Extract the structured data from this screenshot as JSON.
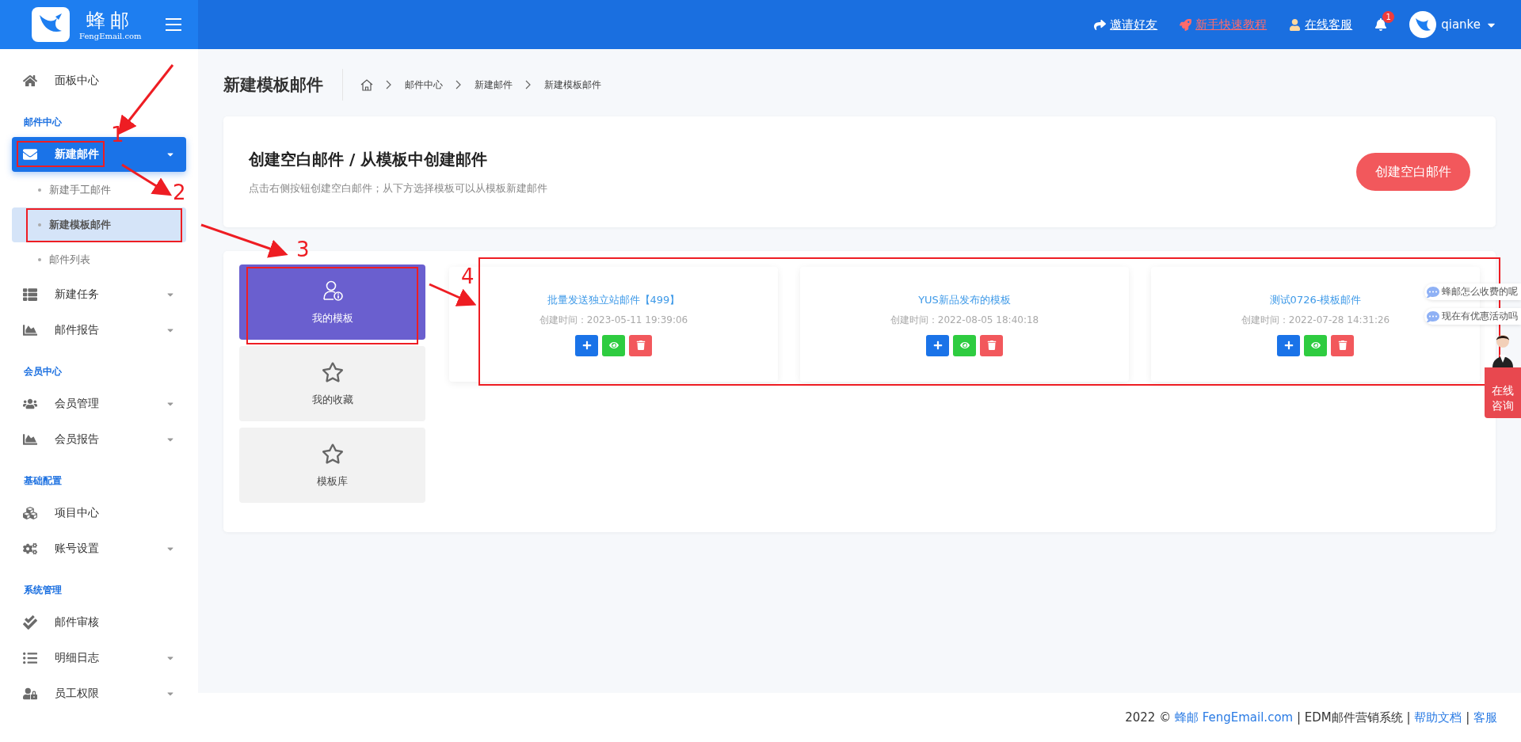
{
  "header": {
    "logo_title": "蜂邮",
    "logo_subtitle": "FengEmail.com",
    "links": [
      {
        "label": "邀请好友",
        "kind": "invite"
      },
      {
        "label": "新手快速教程",
        "kind": "tutorial"
      },
      {
        "label": "在线客服",
        "kind": "service"
      }
    ],
    "notification_count": "1",
    "username": "qianke"
  },
  "sidebar": [
    {
      "kind": "item",
      "label": "面板中心",
      "selected": false,
      "dropdown": false
    },
    {
      "kind": "section",
      "label": "邮件中心"
    },
    {
      "kind": "item",
      "label": "新建邮件",
      "selected": true,
      "dropdown": true
    },
    {
      "kind": "subitem",
      "label": "新建手工邮件",
      "selected": false
    },
    {
      "kind": "subitem",
      "label": "新建模板邮件",
      "selected": true
    },
    {
      "kind": "subitem",
      "label": "邮件列表",
      "selected": false
    },
    {
      "kind": "item",
      "label": "新建任务",
      "selected": false,
      "dropdown": true
    },
    {
      "kind": "item",
      "label": "邮件报告",
      "selected": false,
      "dropdown": true
    },
    {
      "kind": "section",
      "label": "会员中心"
    },
    {
      "kind": "item",
      "label": "会员管理",
      "selected": false,
      "dropdown": true
    },
    {
      "kind": "item",
      "label": "会员报告",
      "selected": false,
      "dropdown": true
    },
    {
      "kind": "section",
      "label": "基础配置"
    },
    {
      "kind": "item",
      "label": "项目中心",
      "selected": false,
      "dropdown": false
    },
    {
      "kind": "item",
      "label": "账号设置",
      "selected": false,
      "dropdown": true
    },
    {
      "kind": "section",
      "label": "系统管理"
    },
    {
      "kind": "item",
      "label": "邮件审核",
      "selected": false,
      "dropdown": false
    },
    {
      "kind": "item",
      "label": "明细日志",
      "selected": false,
      "dropdown": true
    },
    {
      "kind": "item",
      "label": "员工权限",
      "selected": false,
      "dropdown": true
    }
  ],
  "page_title": "新建模板邮件",
  "breadcrumb": [
    "邮件中心",
    "新建邮件",
    "新建模板邮件"
  ],
  "intro": {
    "title": "创建空白邮件 / 从模板中创建邮件",
    "description": "点击右侧按钮创建空白邮件；从下方选择模板可以从模板新建邮件",
    "button": "创建空白邮件"
  },
  "tabs": [
    {
      "label": "我的模板",
      "selected": true
    },
    {
      "label": "我的收藏",
      "selected": false
    },
    {
      "label": "模板库",
      "selected": false
    }
  ],
  "templates": [
    {
      "title": "批量发送独立站邮件【499】",
      "created": "创建时间：2023-05-11 19:39:06"
    },
    {
      "title": "YUS新品发布的模板",
      "created": "创建时间：2022-08-05 18:40:18"
    },
    {
      "title": "测试0726-模板邮件",
      "created": "创建时间：2022-07-28 14:31:26"
    }
  ],
  "chat_widget": {
    "bubbles": [
      "蜂邮怎么收费的呢",
      "现在有优惠活动吗"
    ],
    "button": "在线咨询"
  },
  "footer": {
    "year": "2022 ©",
    "brand_link": "蜂邮 FengEmail.com",
    "system": "| EDM邮件营销系统 |",
    "help_link": "帮助文档",
    "separator": "|",
    "service_link": "客服"
  },
  "annotations": [
    {
      "label": "1"
    },
    {
      "label": "2"
    },
    {
      "label": "3"
    },
    {
      "label": "4"
    }
  ]
}
